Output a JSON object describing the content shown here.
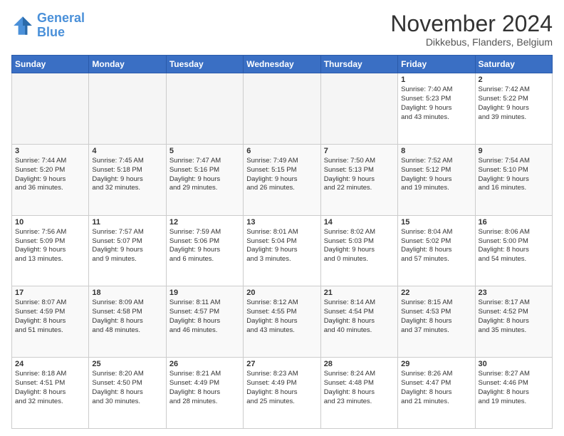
{
  "header": {
    "logo_line1": "General",
    "logo_line2": "Blue",
    "month_year": "November 2024",
    "location": "Dikkebus, Flanders, Belgium"
  },
  "days_of_week": [
    "Sunday",
    "Monday",
    "Tuesday",
    "Wednesday",
    "Thursday",
    "Friday",
    "Saturday"
  ],
  "weeks": [
    [
      {
        "day": "",
        "info": ""
      },
      {
        "day": "",
        "info": ""
      },
      {
        "day": "",
        "info": ""
      },
      {
        "day": "",
        "info": ""
      },
      {
        "day": "",
        "info": ""
      },
      {
        "day": "1",
        "info": "Sunrise: 7:40 AM\nSunset: 5:23 PM\nDaylight: 9 hours\nand 43 minutes."
      },
      {
        "day": "2",
        "info": "Sunrise: 7:42 AM\nSunset: 5:22 PM\nDaylight: 9 hours\nand 39 minutes."
      }
    ],
    [
      {
        "day": "3",
        "info": "Sunrise: 7:44 AM\nSunset: 5:20 PM\nDaylight: 9 hours\nand 36 minutes."
      },
      {
        "day": "4",
        "info": "Sunrise: 7:45 AM\nSunset: 5:18 PM\nDaylight: 9 hours\nand 32 minutes."
      },
      {
        "day": "5",
        "info": "Sunrise: 7:47 AM\nSunset: 5:16 PM\nDaylight: 9 hours\nand 29 minutes."
      },
      {
        "day": "6",
        "info": "Sunrise: 7:49 AM\nSunset: 5:15 PM\nDaylight: 9 hours\nand 26 minutes."
      },
      {
        "day": "7",
        "info": "Sunrise: 7:50 AM\nSunset: 5:13 PM\nDaylight: 9 hours\nand 22 minutes."
      },
      {
        "day": "8",
        "info": "Sunrise: 7:52 AM\nSunset: 5:12 PM\nDaylight: 9 hours\nand 19 minutes."
      },
      {
        "day": "9",
        "info": "Sunrise: 7:54 AM\nSunset: 5:10 PM\nDaylight: 9 hours\nand 16 minutes."
      }
    ],
    [
      {
        "day": "10",
        "info": "Sunrise: 7:56 AM\nSunset: 5:09 PM\nDaylight: 9 hours\nand 13 minutes."
      },
      {
        "day": "11",
        "info": "Sunrise: 7:57 AM\nSunset: 5:07 PM\nDaylight: 9 hours\nand 9 minutes."
      },
      {
        "day": "12",
        "info": "Sunrise: 7:59 AM\nSunset: 5:06 PM\nDaylight: 9 hours\nand 6 minutes."
      },
      {
        "day": "13",
        "info": "Sunrise: 8:01 AM\nSunset: 5:04 PM\nDaylight: 9 hours\nand 3 minutes."
      },
      {
        "day": "14",
        "info": "Sunrise: 8:02 AM\nSunset: 5:03 PM\nDaylight: 9 hours\nand 0 minutes."
      },
      {
        "day": "15",
        "info": "Sunrise: 8:04 AM\nSunset: 5:02 PM\nDaylight: 8 hours\nand 57 minutes."
      },
      {
        "day": "16",
        "info": "Sunrise: 8:06 AM\nSunset: 5:00 PM\nDaylight: 8 hours\nand 54 minutes."
      }
    ],
    [
      {
        "day": "17",
        "info": "Sunrise: 8:07 AM\nSunset: 4:59 PM\nDaylight: 8 hours\nand 51 minutes."
      },
      {
        "day": "18",
        "info": "Sunrise: 8:09 AM\nSunset: 4:58 PM\nDaylight: 8 hours\nand 48 minutes."
      },
      {
        "day": "19",
        "info": "Sunrise: 8:11 AM\nSunset: 4:57 PM\nDaylight: 8 hours\nand 46 minutes."
      },
      {
        "day": "20",
        "info": "Sunrise: 8:12 AM\nSunset: 4:55 PM\nDaylight: 8 hours\nand 43 minutes."
      },
      {
        "day": "21",
        "info": "Sunrise: 8:14 AM\nSunset: 4:54 PM\nDaylight: 8 hours\nand 40 minutes."
      },
      {
        "day": "22",
        "info": "Sunrise: 8:15 AM\nSunset: 4:53 PM\nDaylight: 8 hours\nand 37 minutes."
      },
      {
        "day": "23",
        "info": "Sunrise: 8:17 AM\nSunset: 4:52 PM\nDaylight: 8 hours\nand 35 minutes."
      }
    ],
    [
      {
        "day": "24",
        "info": "Sunrise: 8:18 AM\nSunset: 4:51 PM\nDaylight: 8 hours\nand 32 minutes."
      },
      {
        "day": "25",
        "info": "Sunrise: 8:20 AM\nSunset: 4:50 PM\nDaylight: 8 hours\nand 30 minutes."
      },
      {
        "day": "26",
        "info": "Sunrise: 8:21 AM\nSunset: 4:49 PM\nDaylight: 8 hours\nand 28 minutes."
      },
      {
        "day": "27",
        "info": "Sunrise: 8:23 AM\nSunset: 4:49 PM\nDaylight: 8 hours\nand 25 minutes."
      },
      {
        "day": "28",
        "info": "Sunrise: 8:24 AM\nSunset: 4:48 PM\nDaylight: 8 hours\nand 23 minutes."
      },
      {
        "day": "29",
        "info": "Sunrise: 8:26 AM\nSunset: 4:47 PM\nDaylight: 8 hours\nand 21 minutes."
      },
      {
        "day": "30",
        "info": "Sunrise: 8:27 AM\nSunset: 4:46 PM\nDaylight: 8 hours\nand 19 minutes."
      }
    ]
  ]
}
